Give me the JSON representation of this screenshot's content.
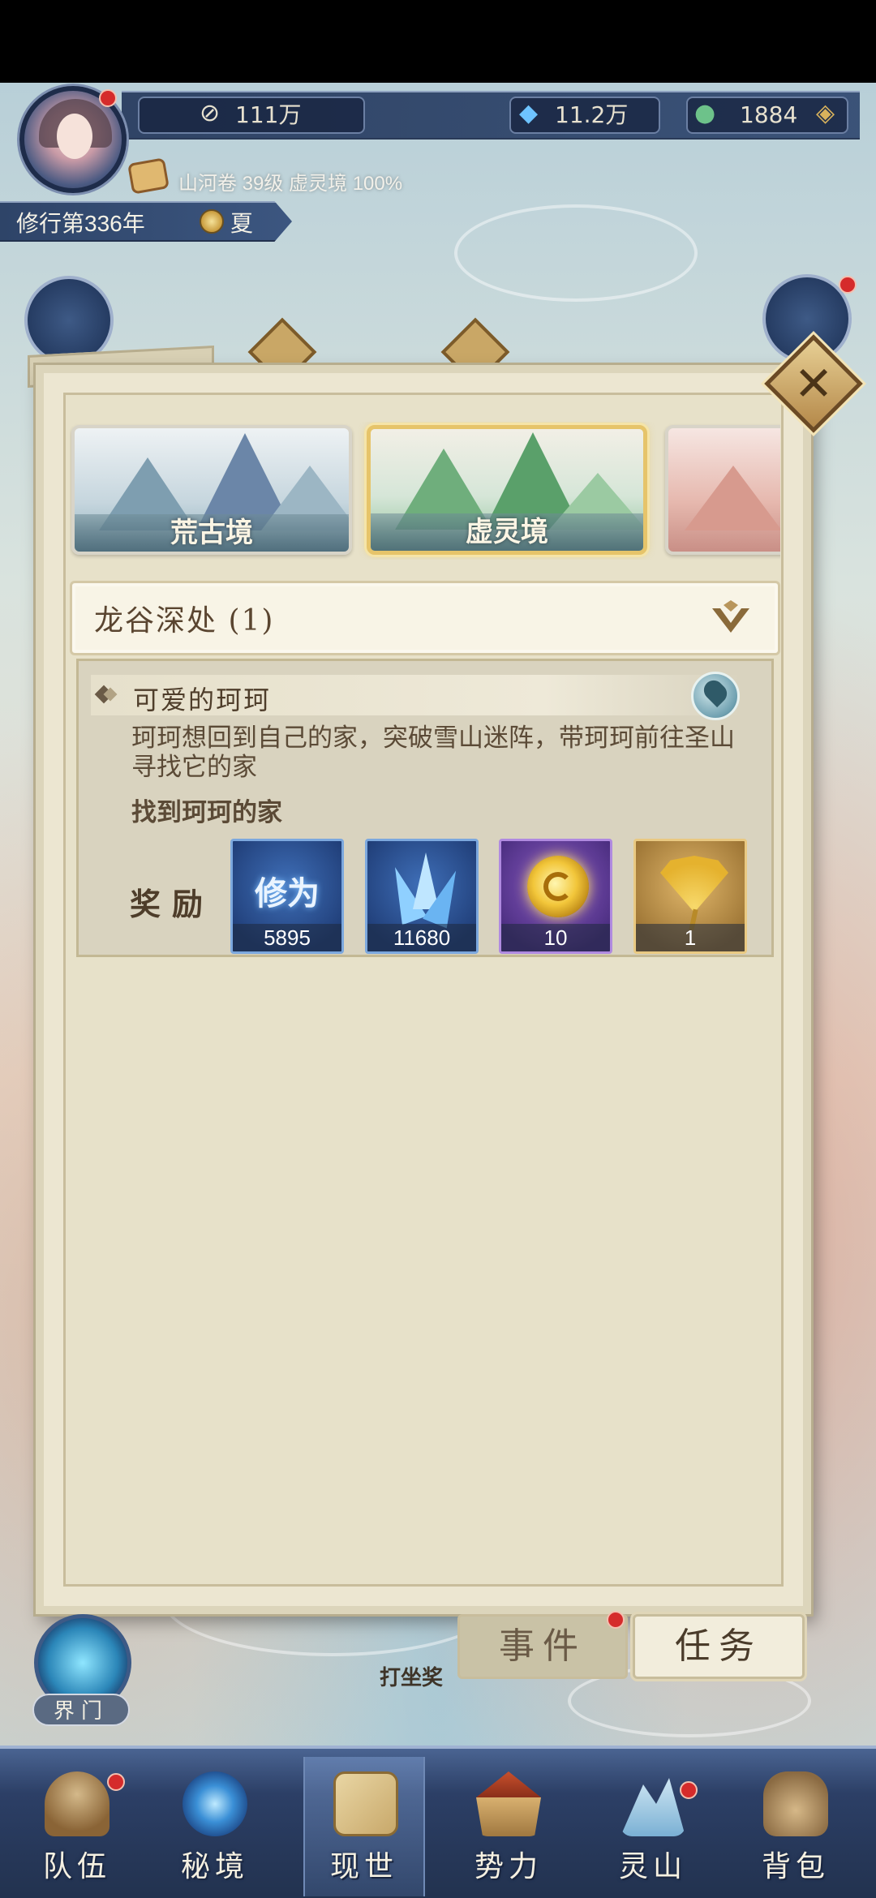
{
  "hud": {
    "combat_power": "111万",
    "spirit_stones": "11.2万",
    "jade": "1884",
    "sub_info": "山河卷 39级 虚灵境 100%",
    "year": "修行第336年",
    "season": "夏"
  },
  "realms": [
    {
      "label": "荒古境",
      "selected": false
    },
    {
      "label": "虚灵境",
      "selected": true
    }
  ],
  "section": {
    "title": "龙谷深处 (1)"
  },
  "quest": {
    "title": "可爱的珂珂",
    "description": "珂珂想回到自己的家，突破雪山迷阵，带珂珂前往圣山寻找它的家",
    "goal": "找到珂珂的家",
    "reward_label": "奖励",
    "rewards": [
      {
        "icon": "xiuwei-icon",
        "name": "修为",
        "qty": "5895"
      },
      {
        "icon": "crystal-icon",
        "qty": "11680"
      },
      {
        "icon": "golden-orb-icon",
        "qty": "10"
      },
      {
        "icon": "ginkgo-leaf-icon",
        "qty": "1"
      }
    ]
  },
  "tabs": {
    "event": "事件",
    "task": "任务",
    "active": "任务"
  },
  "map_labels": {
    "portal": "界门",
    "meditate": "打坐奖"
  },
  "nav": [
    {
      "label": "队伍",
      "icon": "team-icon",
      "badge": true
    },
    {
      "label": "秘境",
      "icon": "secret-realm-icon",
      "badge": false
    },
    {
      "label": "现世",
      "icon": "world-map-icon",
      "badge": false,
      "active": true
    },
    {
      "label": "势力",
      "icon": "faction-icon",
      "badge": false
    },
    {
      "label": "灵山",
      "icon": "spirit-mountain-icon",
      "badge": true
    },
    {
      "label": "背包",
      "icon": "backpack-icon",
      "badge": false
    }
  ],
  "colors": {
    "panel_bg": "#ece6d1",
    "hud_blue": "#2e4468",
    "gold_accent": "#e6c46a",
    "badge_red": "#d52b2b"
  }
}
